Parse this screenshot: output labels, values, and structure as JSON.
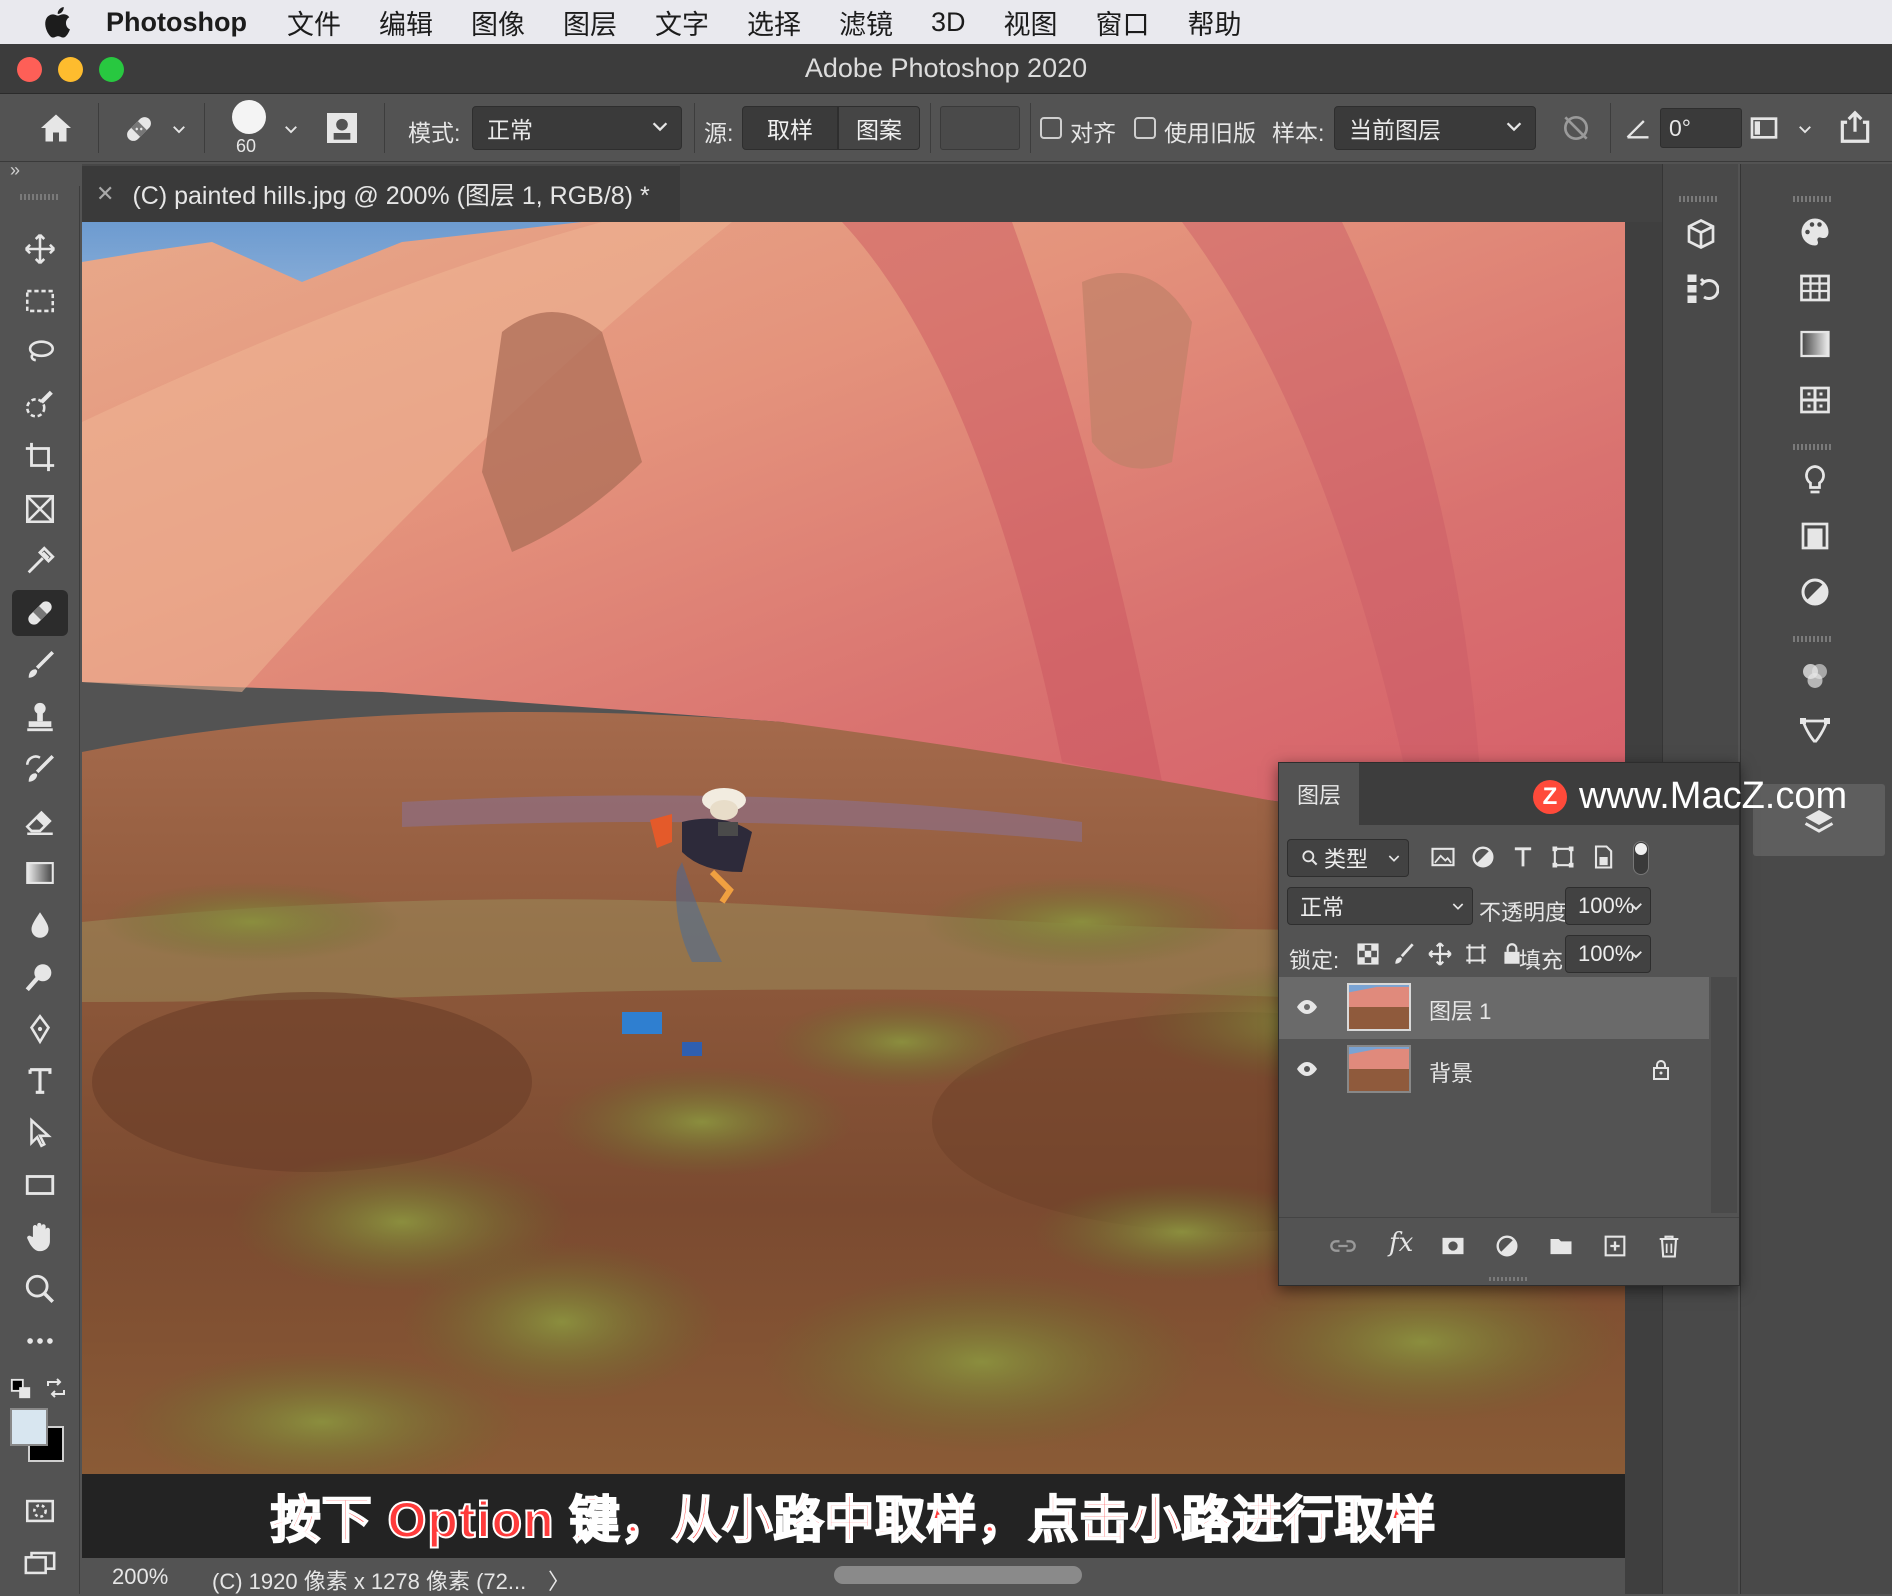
{
  "menubar": {
    "app": "Photoshop",
    "items": [
      "文件",
      "编辑",
      "图像",
      "图层",
      "文字",
      "选择",
      "滤镜",
      "3D",
      "视图",
      "窗口",
      "帮助"
    ]
  },
  "window": {
    "title": "Adobe Photoshop 2020"
  },
  "options": {
    "brush_size": "60",
    "mode_label": "模式:",
    "mode_value": "正常",
    "source_label": "源:",
    "source_sampled": "取样",
    "source_pattern": "图案",
    "align_label": "对齐",
    "legacy_label": "使用旧版",
    "sample_label": "样本:",
    "sample_value": "当前图层",
    "angle_value": "0°"
  },
  "document": {
    "tab_title": "(C) painted hills.jpg @ 200% (图层 1, RGB/8) *"
  },
  "caption": "按下 Option 键，从小路中取样，点击小路进行取样",
  "status": {
    "zoom": "200%",
    "info": "(C) 1920 像素 x 1278 像素 (72...",
    "arrow": "〉"
  },
  "layers_panel": {
    "tab": "图层",
    "watermark": "www.MacZ.com",
    "watermark_badge": "Z",
    "filter_kind": "类型",
    "blend_mode": "正常",
    "opacity_label": "不透明度:",
    "opacity_value": "100%",
    "lock_label": "锁定:",
    "fill_label": "填充:",
    "fill_value": "100%",
    "layers": [
      {
        "name": "图层 1",
        "selected": true,
        "locked": false
      },
      {
        "name": "背景",
        "selected": false,
        "locked": true
      }
    ]
  },
  "colors": {
    "foreground": "#d8e6f0",
    "background": "#000000",
    "caption_text": "#ff3b3b",
    "watermark_badge": "#ff4a3a"
  },
  "tools": [
    "move-tool",
    "marquee-tool",
    "lasso-tool",
    "quick-select-tool",
    "crop-tool",
    "frame-tool",
    "eyedropper-tool",
    "healing-brush-tool",
    "brush-tool",
    "clone-stamp-tool",
    "history-brush-tool",
    "eraser-tool",
    "gradient-tool",
    "blur-tool",
    "dodge-tool",
    "pen-tool",
    "type-tool",
    "path-select-tool",
    "rectangle-tool",
    "hand-tool",
    "zoom-tool",
    "more-tools"
  ]
}
